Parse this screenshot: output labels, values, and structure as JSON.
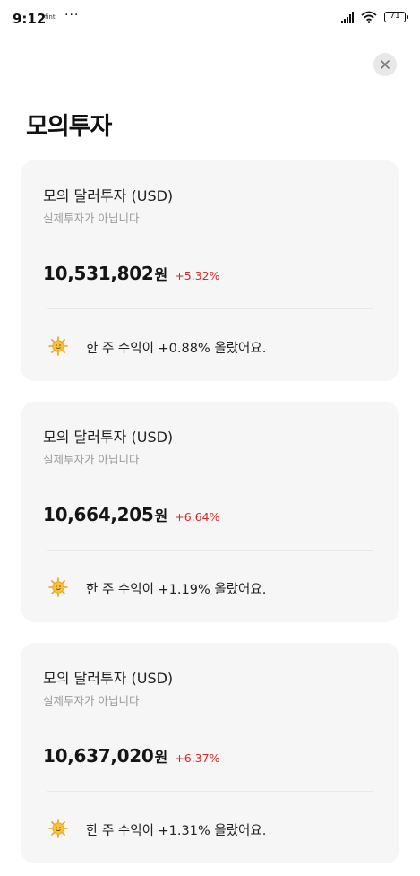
{
  "status_bar": {
    "time": "9:12",
    "app_label": "fint",
    "dots": "···",
    "battery": "71"
  },
  "page": {
    "title": "모의투자"
  },
  "cards": [
    {
      "title": "모의 달러투자 (USD)",
      "subtitle": "실제투자가 아닙니다",
      "amount": "10,531,802",
      "unit": "원",
      "change": "+5.32%",
      "weekly_text": "한 주 수익이 +0.88% 올랐어요."
    },
    {
      "title": "모의 달러투자 (USD)",
      "subtitle": "실제투자가 아닙니다",
      "amount": "10,664,205",
      "unit": "원",
      "change": "+6.64%",
      "weekly_text": "한 주 수익이 +1.19% 올랐어요."
    },
    {
      "title": "모의 달러투자 (USD)",
      "subtitle": "실제투자가 아닙니다",
      "amount": "10,637,020",
      "unit": "원",
      "change": "+6.37%",
      "weekly_text": "한 주 수익이 +1.31% 올랐어요."
    }
  ],
  "icons": {
    "close": "close-icon",
    "sun": "sun-icon"
  },
  "colors": {
    "positive_change": "#d42a2a",
    "card_background": "#f6f6f6",
    "subtitle_gray": "#9a9a9a",
    "close_button_bg": "#e8e8ea"
  }
}
